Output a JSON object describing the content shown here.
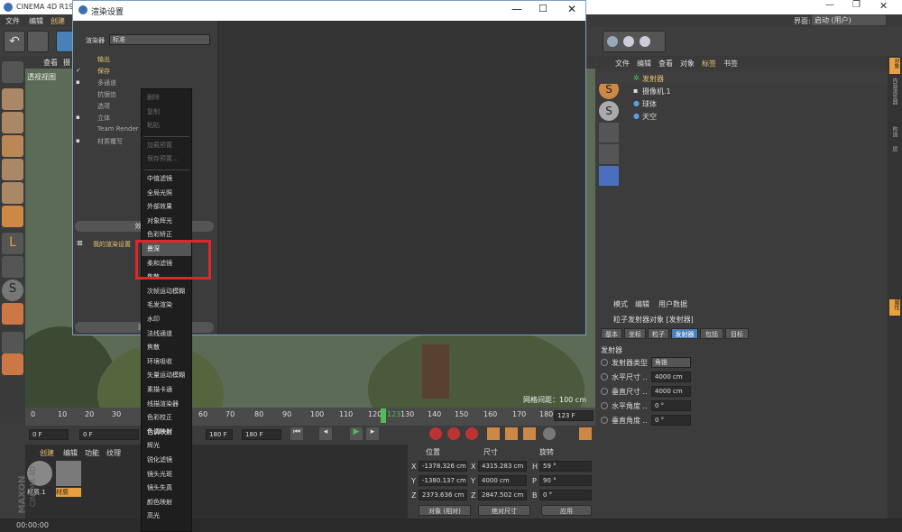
{
  "app": {
    "title": "CINEMA 4D R19",
    "menu": [
      "文件",
      "编辑",
      "创建"
    ],
    "interface_label": "界面:",
    "interface_value": "启动 (用户)"
  },
  "viewport": {
    "menu": [
      "查看",
      "摄"
    ],
    "name": "透视视图",
    "grid_spacing": "网格间距：100 cm"
  },
  "timeline": {
    "ticks": [
      "0",
      "10",
      "20",
      "30",
      "60",
      "70",
      "80",
      "90",
      "100",
      "110",
      "120",
      "130",
      "140",
      "150",
      "160",
      "170",
      "180"
    ],
    "current_frame_label": "123",
    "frame_field": "123 F",
    "start_frame": "0 F",
    "start_frame2": "0 F",
    "end_frame": "180 F",
    "end_frame2": "180 F"
  },
  "materials": {
    "tabs": [
      "创建",
      "编辑",
      "功能",
      "纹理"
    ],
    "items": [
      "材质.1",
      "材质"
    ],
    "brand1": "MAXON",
    "brand2": "CINEMA 4D"
  },
  "coords": {
    "headers": [
      "位置",
      "尺寸",
      "旋转"
    ],
    "rows": [
      {
        "axis": "X",
        "pos": "-1378.326 cm",
        "size_axis": "X",
        "size": "4315.283 cm",
        "rot_axis": "H",
        "rot": "59 °"
      },
      {
        "axis": "Y",
        "pos": "-1380.137 cm",
        "size_axis": "Y",
        "size": "4000 cm",
        "rot_axis": "P",
        "rot": "90 °"
      },
      {
        "axis": "Z",
        "pos": "2373.636 cm",
        "size_axis": "Z",
        "size": "2847.502 cm",
        "rot_axis": "B",
        "rot": "0 °"
      }
    ],
    "mode": "对象 (相对)",
    "size_mode": "绝对尺寸",
    "apply": "应用"
  },
  "status": {
    "time": "00:00:00"
  },
  "object_manager": {
    "menu": [
      "文件",
      "编辑",
      "查看",
      "对象",
      "标签",
      "书签"
    ],
    "objects": [
      "发射器",
      "摄像机.1",
      "球体",
      "天空"
    ],
    "side_tabs": [
      "对象",
      "内容浏览器",
      "构造",
      "层"
    ]
  },
  "attributes": {
    "menu": [
      "模式",
      "编辑",
      "用户数据"
    ],
    "object_title": "粒子发射器对象 [发射器]",
    "tabs": [
      "基本",
      "坐标",
      "粒子",
      "发射器",
      "包括",
      "目标"
    ],
    "active_tab": "发射器",
    "section": "发射器",
    "fields": [
      {
        "label": "发射器类型",
        "value": "角锥"
      },
      {
        "label": "水平尺寸 ..",
        "value": "4000 cm"
      },
      {
        "label": "垂直尺寸 ..",
        "value": "4000 cm"
      },
      {
        "label": "水平角度 ..",
        "value": "0 °"
      },
      {
        "label": "垂直角度 ..",
        "value": "0 °"
      }
    ],
    "side_tabs": [
      "属性"
    ]
  },
  "render_settings": {
    "title": "渲染设置",
    "renderer_label": "渲染器",
    "renderer_value": "标准",
    "items": [
      {
        "label": "输出",
        "check": ""
      },
      {
        "label": "保存",
        "check": "✓"
      },
      {
        "label": "多通道",
        "check": "▪"
      },
      {
        "label": "抗锯齿",
        "check": ""
      },
      {
        "label": "选项",
        "check": ""
      },
      {
        "label": "立体",
        "check": "▪"
      },
      {
        "label": "Team Render",
        "check": ""
      },
      {
        "label": "材质覆写",
        "check": "▪"
      }
    ],
    "effects_button": "效果...",
    "my_settings": "我的渲染设置",
    "render_button": "渲染"
  },
  "context_menu": {
    "items": [
      {
        "label": "删除",
        "state": "disabled"
      },
      {
        "label": "复制",
        "state": "disabled"
      },
      {
        "label": "粘贴",
        "state": "disabled"
      },
      {
        "label": "加载预置",
        "state": "disabled"
      },
      {
        "label": "保存预置...",
        "state": "disabled"
      },
      {
        "label": "中值滤镜",
        "state": "normal"
      },
      {
        "label": "全局光照",
        "state": "normal"
      },
      {
        "label": "外部效果",
        "state": "normal"
      },
      {
        "label": "对象辉光",
        "state": "normal"
      },
      {
        "label": "色彩矫正",
        "state": "normal"
      },
      {
        "label": "景深",
        "state": "highlight"
      },
      {
        "label": "柔和滤镜",
        "state": "normal"
      },
      {
        "label": "焦散",
        "state": "normal"
      },
      {
        "label": "次帧运动模糊",
        "state": "normal"
      },
      {
        "label": "毛发渲染",
        "state": "normal"
      },
      {
        "label": "水印",
        "state": "normal"
      },
      {
        "label": "法线通道",
        "state": "normal"
      },
      {
        "label": "焦散",
        "state": "normal"
      },
      {
        "label": "环境吸收",
        "state": "normal"
      },
      {
        "label": "矢量运动模糊",
        "state": "normal"
      },
      {
        "label": "素描卡通",
        "state": "normal"
      },
      {
        "label": "线描渲染器",
        "state": "normal"
      },
      {
        "label": "色彩校正",
        "state": "normal"
      },
      {
        "label": "色调映射",
        "state": "bold"
      },
      {
        "label": "辉光",
        "state": "normal"
      },
      {
        "label": "锐化滤镜",
        "state": "normal"
      },
      {
        "label": "镜头光斑",
        "state": "normal"
      },
      {
        "label": "镜头失真",
        "state": "normal"
      },
      {
        "label": "颜色映射",
        "state": "normal"
      },
      {
        "label": "高光",
        "state": "normal"
      }
    ]
  }
}
